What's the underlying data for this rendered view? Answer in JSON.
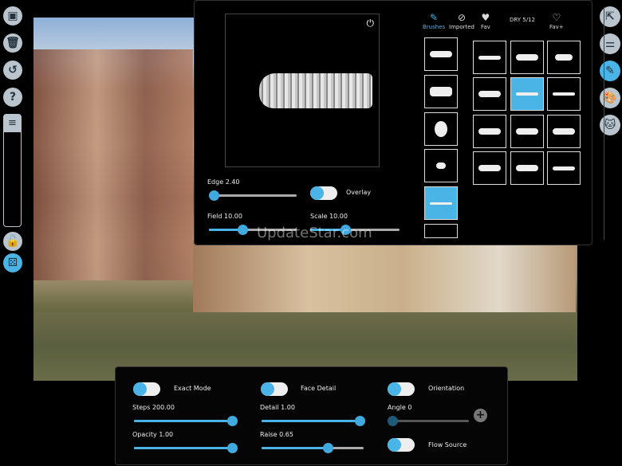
{
  "watermark": "UpdateStar.com",
  "left_toolbar": [
    {
      "icon": "image-icon"
    },
    {
      "icon": "trash-icon"
    },
    {
      "icon": "undo-icon"
    },
    {
      "icon": "help-icon"
    },
    {
      "icon": "menu-icon"
    },
    {
      "icon": "unlock-icon"
    },
    {
      "icon": "dice-icon"
    }
  ],
  "right_toolbar": [
    {
      "icon": "export-icon"
    },
    {
      "icon": "toggle-settings-icon"
    },
    {
      "icon": "brush-icon"
    },
    {
      "icon": "palette-icon"
    },
    {
      "icon": "cat-icon"
    }
  ],
  "brush_panel": {
    "tabs": [
      {
        "label": "Brushes",
        "active": true
      },
      {
        "label": "Imported"
      },
      {
        "label": "Fav"
      },
      {
        "label": "DRY 5/12"
      },
      {
        "label": "Fav+"
      }
    ],
    "edge": {
      "label": "Edge",
      "value": "2.40",
      "fraction": 0.05
    },
    "overlay": {
      "label": "Overlay",
      "on": true
    },
    "field": {
      "label": "Field",
      "value": "10.00",
      "fraction": 0.38
    },
    "scale": {
      "label": "Scale",
      "value": "10.00",
      "fraction": 0.38
    },
    "accent": "#4ab4e6"
  },
  "controls": {
    "exact_mode": {
      "label": "Exact Mode",
      "on": true
    },
    "face_detail": {
      "label": "Face Detail",
      "on": true
    },
    "orientation": {
      "label": "Orientation",
      "on": true
    },
    "steps": {
      "label": "Steps",
      "value": "200.00",
      "fraction": 1.0
    },
    "detail": {
      "label": "Detail",
      "value": "1.00",
      "fraction": 1.0
    },
    "angle": {
      "label": "Angle",
      "value": "0",
      "fraction": 0.0
    },
    "opacity": {
      "label": "Opacity",
      "value": "1.00",
      "fraction": 1.0
    },
    "raise": {
      "label": "Raise",
      "value": "0.65",
      "fraction": 0.65
    },
    "flow_source": {
      "label": "Flow Source",
      "on": true
    }
  }
}
